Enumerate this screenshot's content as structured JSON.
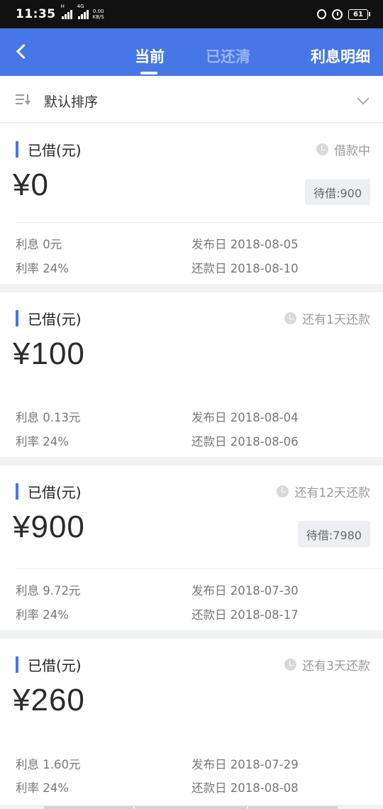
{
  "status_bar": {
    "time": "11:35",
    "network_tag": "H",
    "network_tag2": "4G",
    "speed_value": "0.00",
    "speed_unit": "KB/S",
    "battery": "61"
  },
  "header": {
    "back_icon": "back-arrow-icon",
    "tabs": [
      {
        "label": "当前",
        "active": true
      },
      {
        "label": "已还清",
        "active": false
      }
    ],
    "right_action": "利息明细",
    "brand_color": "#4776e6"
  },
  "sort": {
    "label": "默认排序",
    "icon": "sort-icon",
    "chevron": "chevron-down-icon"
  },
  "loans": [
    {
      "title": "已借(元)",
      "status": "借款中",
      "amount": "¥0",
      "pending": "待借:900",
      "interest": "利息 0元",
      "rate": "利率 24%",
      "issue_date": "发布日 2018-08-05",
      "repay_date": "还款日 2018-08-10"
    },
    {
      "title": "已借(元)",
      "status": "还有1天还款",
      "amount": "¥100",
      "pending": "",
      "interest": "利息 0.13元",
      "rate": "利率 24%",
      "issue_date": "发布日 2018-08-04",
      "repay_date": "还款日 2018-08-06"
    },
    {
      "title": "已借(元)",
      "status": "还有12天还款",
      "amount": "¥900",
      "pending": "待借:7980",
      "interest": "利息 9.72元",
      "rate": "利率 24%",
      "issue_date": "发布日 2018-07-30",
      "repay_date": "还款日 2018-08-17"
    },
    {
      "title": "已借(元)",
      "status": "还有3天还款",
      "amount": "¥260",
      "pending": "",
      "interest": "利息 1.60元",
      "rate": "利率 24%",
      "issue_date": "发布日 2018-07-29",
      "repay_date": "还款日 2018-08-08"
    }
  ]
}
